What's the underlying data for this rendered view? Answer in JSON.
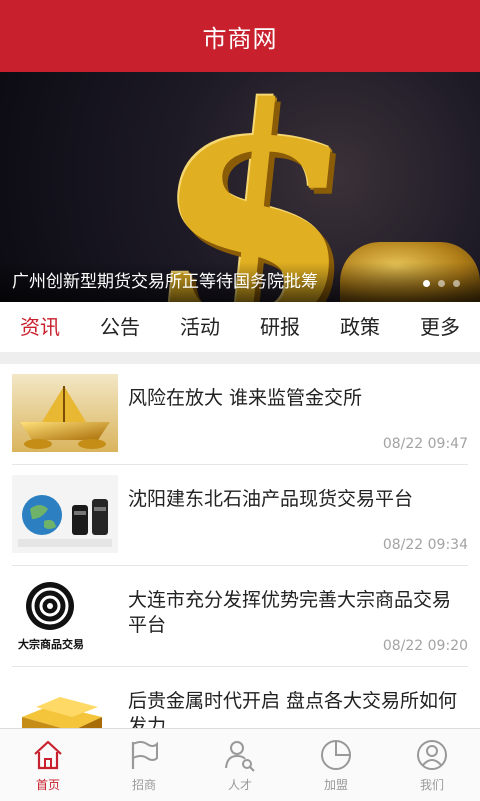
{
  "header": {
    "title": "市商网"
  },
  "banner": {
    "caption": "广州创新型期货交易所正等待国务院批筹",
    "dots": 3,
    "active_dot": 0
  },
  "tabs": [
    {
      "label": "资讯",
      "active": true
    },
    {
      "label": "公告",
      "active": false
    },
    {
      "label": "活动",
      "active": false
    },
    {
      "label": "研报",
      "active": false
    },
    {
      "label": "政策",
      "active": false
    },
    {
      "label": "更多",
      "active": false
    }
  ],
  "news": [
    {
      "title": "风险在放大 谁来监管金交所",
      "time": "08/22 09:47",
      "thumb": "gold-ship"
    },
    {
      "title": "沈阳建东北石油产品现货交易平台",
      "time": "08/22 09:34",
      "thumb": "globe-oil-barrels"
    },
    {
      "title": "大连市充分发挥优势完善大宗商品交易平台",
      "time": "08/22 09:20",
      "thumb": "commodity-logo",
      "thumb_text": "大宗商品交易"
    },
    {
      "title": "后贵金属时代开启 盘点各大交易所如何发力",
      "time": "",
      "thumb": "gold-bars"
    }
  ],
  "tabbar": [
    {
      "label": "首页",
      "icon": "home-icon",
      "active": true
    },
    {
      "label": "招商",
      "icon": "flag-icon",
      "active": false
    },
    {
      "label": "人才",
      "icon": "person-search-icon",
      "active": false
    },
    {
      "label": "加盟",
      "icon": "pie-chart-icon",
      "active": false
    },
    {
      "label": "我们",
      "icon": "user-circle-icon",
      "active": false
    }
  ],
  "colors": {
    "brand": "#c8202c",
    "inactive": "#999999"
  }
}
